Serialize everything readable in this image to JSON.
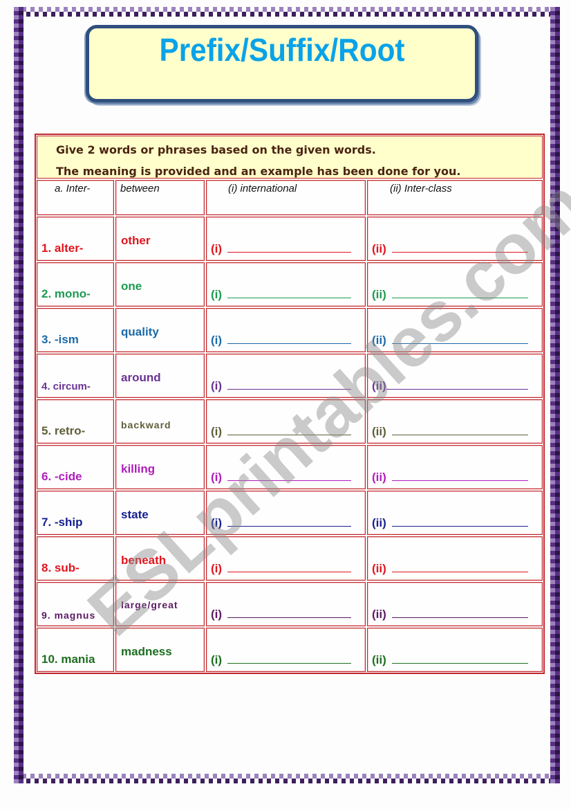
{
  "title": "Prefix/Suffix/Root",
  "instructions": [
    "Give 2 words or phrases based on the given words.",
    "The meaning is provided and an example has been done for you."
  ],
  "example": {
    "prefix": "a.  Inter-",
    "meaning": "between",
    "answer_i": "(i)  international",
    "answer_ii": "(ii) Inter-class"
  },
  "answer_labels": {
    "i": "(i)",
    "ii": "(ii)"
  },
  "items": [
    {
      "prefix": "1. alter-",
      "meaning": "other",
      "color": "#e0141c",
      "answer_i": "",
      "answer_ii": ""
    },
    {
      "prefix": "2. mono-",
      "meaning": "one",
      "color": "#1c9a50",
      "answer_i": "",
      "answer_ii": ""
    },
    {
      "prefix": "3. -ism",
      "meaning": "quality",
      "color": "#1b6aa8",
      "answer_i": "",
      "answer_ii": ""
    },
    {
      "prefix": "4. circum-",
      "meaning": "around",
      "color": "#6a3293",
      "answer_i": "",
      "answer_ii": ""
    },
    {
      "prefix": "5. retro-",
      "meaning": "backward",
      "color": "#5e5e3a",
      "answer_i": "",
      "answer_ii": ""
    },
    {
      "prefix": "6. -cide",
      "meaning": "killing",
      "color": "#b01cbd",
      "answer_i": "",
      "answer_ii": ""
    },
    {
      "prefix": "7. -ship",
      "meaning": "state",
      "color": "#16218f",
      "answer_i": "",
      "answer_ii": ""
    },
    {
      "prefix": "8. sub-",
      "meaning": "beneath",
      "color": "#e0141c",
      "answer_i": "",
      "answer_ii": ""
    },
    {
      "prefix": "9. magnus",
      "meaning": "large/great",
      "color": "#5a1a63",
      "answer_i": "",
      "answer_ii": ""
    },
    {
      "prefix": "10. mania",
      "meaning": "madness",
      "color": "#1c6e1f",
      "answer_i": "",
      "answer_ii": ""
    }
  ],
  "watermark": "ESLprintables.com",
  "colors": {
    "title": "#0aa2e8",
    "title_box_bg": "#ffffcc",
    "title_box_border": "#2f4f7e",
    "table_border": "#c0282d",
    "instruction_text": "#4a2410",
    "page_border_light": "#9b83bd",
    "page_border_dark": "#3e1f5e"
  }
}
